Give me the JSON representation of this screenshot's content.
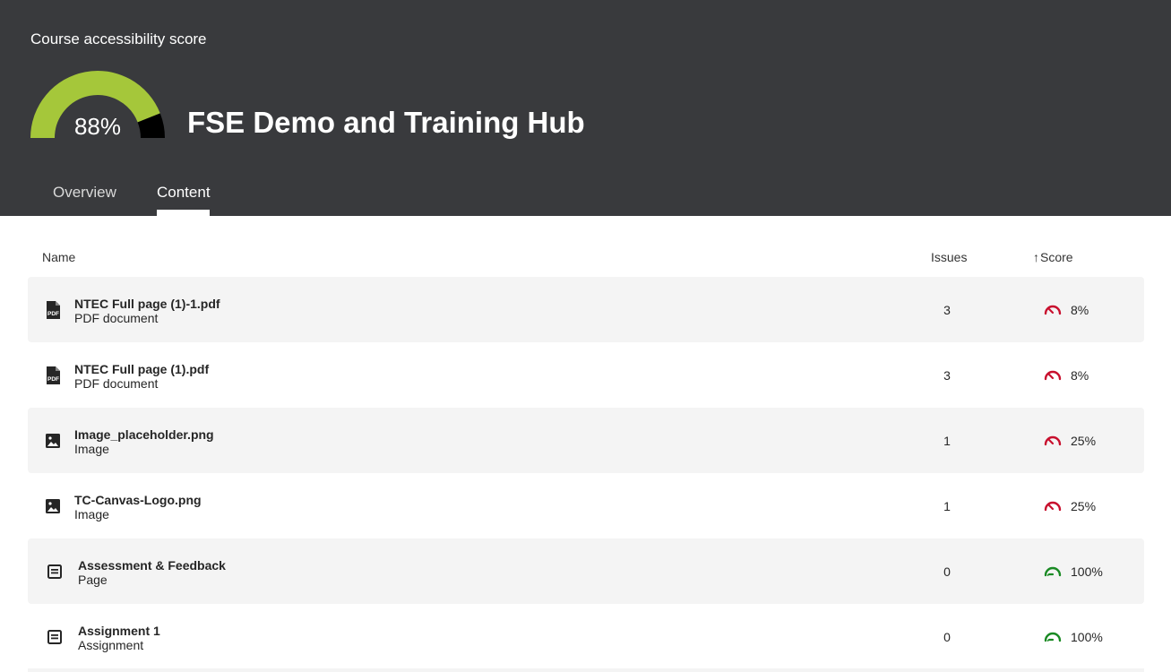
{
  "header": {
    "score_label": "Course accessibility score",
    "score_value": "88%",
    "score_fraction": 0.88,
    "course_title": "FSE Demo and Training Hub",
    "gauge_fill_color": "#a5c73a",
    "gauge_rest_color": "#000000"
  },
  "tabs": [
    {
      "label": "Overview",
      "active": false
    },
    {
      "label": "Content",
      "active": true
    }
  ],
  "table": {
    "columns": {
      "name": "Name",
      "issues": "Issues",
      "score": "Score",
      "score_sort": "ascending"
    },
    "rows": [
      {
        "name": "NTEC Full page (1)-1.pdf",
        "type": "PDF document",
        "icon": "pdf-icon",
        "issues": "3",
        "score": "8%",
        "status": "low"
      },
      {
        "name": "NTEC Full page (1).pdf",
        "type": "PDF document",
        "icon": "pdf-icon",
        "issues": "3",
        "score": "8%",
        "status": "low"
      },
      {
        "name": "Image_placeholder.png",
        "type": "Image",
        "icon": "image-icon",
        "issues": "1",
        "score": "25%",
        "status": "low"
      },
      {
        "name": "TC-Canvas-Logo.png",
        "type": "Image",
        "icon": "image-icon",
        "issues": "1",
        "score": "25%",
        "status": "low"
      },
      {
        "name": "Assessment & Feedback",
        "type": "Page",
        "icon": "page-icon",
        "issues": "0",
        "score": "100%",
        "status": "high"
      },
      {
        "name": "Assignment 1",
        "type": "Assignment",
        "icon": "page-icon",
        "issues": "0",
        "score": "100%",
        "status": "high"
      }
    ]
  },
  "colors": {
    "header_bg": "#393a3d",
    "low_score": "#c8102e",
    "high_score": "#1a8a24",
    "row_shade": "#f4f4f4"
  }
}
